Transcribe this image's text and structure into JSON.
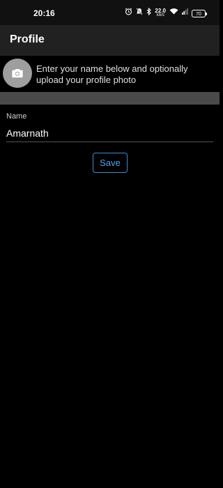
{
  "status_bar": {
    "time": "20:16",
    "net_speed_value": "22.0",
    "net_speed_unit": "KB/S",
    "battery_level": "70",
    "icons": [
      "alarm-icon",
      "mute-icon",
      "bluetooth-icon",
      "net-speed",
      "wifi-icon",
      "signal-icon",
      "battery-icon"
    ]
  },
  "app_bar": {
    "title": "Profile"
  },
  "photo_section": {
    "avatar_icon": "camera-icon",
    "hint": "Enter your name below and optionally upload your profile photo"
  },
  "form": {
    "name_label": "Name",
    "name_value": "Amarnath",
    "save_label": "Save"
  },
  "colors": {
    "background": "#000000",
    "app_bar": "#212121",
    "accent": "#4aa3f0",
    "avatar": "#9e9e9e"
  }
}
